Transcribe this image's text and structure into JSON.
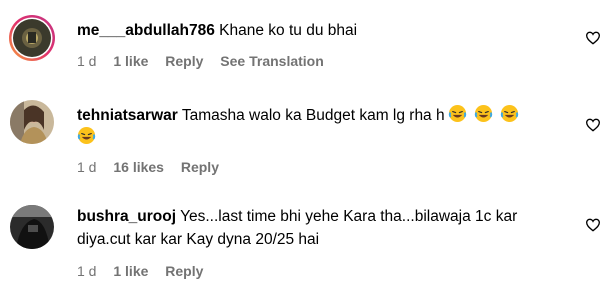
{
  "comments": [
    {
      "username": "me___abdullah786",
      "text": "Khane ko tu du bhai",
      "time": "1 d",
      "likes": "1 like",
      "reply": "Reply",
      "translation": "See Translation"
    },
    {
      "username": "tehniatsarwar",
      "text": "Tamasha walo ka Budget kam lg rha h",
      "time": "1 d",
      "likes": "16 likes",
      "reply": "Reply",
      "emoji": "laughing-emoji"
    },
    {
      "username": "bushra_urooj",
      "text_line1": "Yes...last time bhi yehe Kara tha...bilawaja 1c kar",
      "text_line2": "diya.cut kar kar Kay dyna 20/25 hai",
      "time": "1 d",
      "likes": "1 like",
      "reply": "Reply"
    }
  ],
  "colors": {
    "meta_text": "#737373",
    "avatar_ring_start": "#f58529",
    "avatar_ring_end": "#dd2a7b"
  }
}
